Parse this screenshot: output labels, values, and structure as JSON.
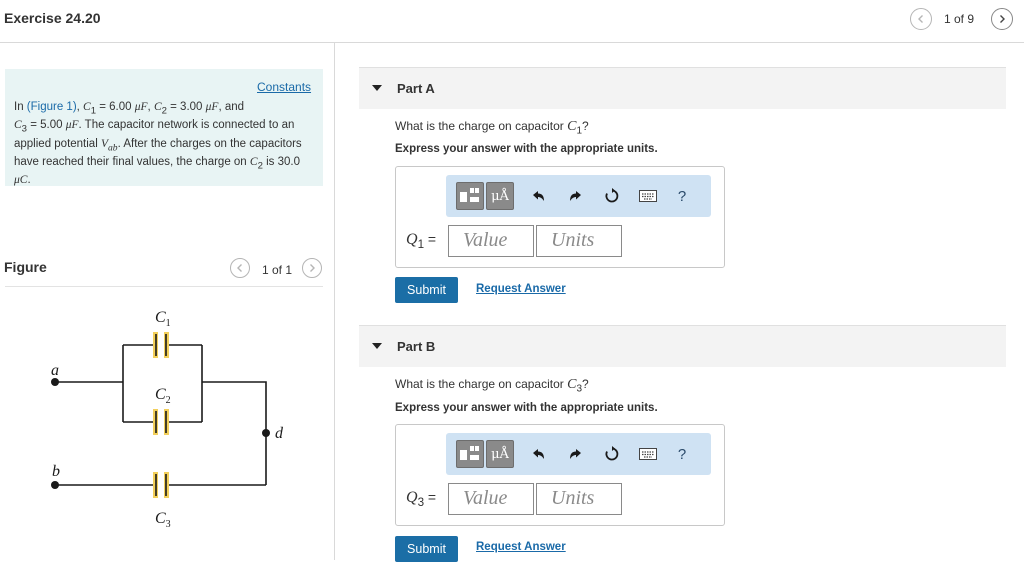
{
  "header": {
    "title": "Exercise 24.20",
    "page_count": "1 of 9"
  },
  "problem": {
    "constants_link": "Constants",
    "intro": "In ",
    "figure_link": "(Figure 1)",
    "c1_label": "C",
    "c1_sub": "1",
    "c1_value": " = 6.00 ",
    "c1_unit": "μF",
    "c2_label": "C",
    "c2_sub": "2",
    "c2_value": " = 3.00 ",
    "c2_unit": "μF",
    "and_text": ", and",
    "c3_label": "C",
    "c3_sub": "3",
    "c3_value": " = 5.00 ",
    "c3_unit": "μF",
    "text_1": ". The capacitor network is connected to an applied potential ",
    "vab_label": "V",
    "vab_sub": "ab",
    "text_2": ". After the charges on the capacitors have reached their final values, the charge on ",
    "c2b_label": "C",
    "c2b_sub": "2",
    "text_3": " is 30.0 ",
    "charge_unit": "μC",
    "period": "."
  },
  "figure": {
    "heading": "Figure",
    "count": "1 of 1",
    "labels": {
      "c1": "C",
      "c1_sub": "1",
      "c2": "C",
      "c2_sub": "2",
      "c3": "C",
      "c3_sub": "3",
      "a": "a",
      "b": "b",
      "d": "d"
    },
    "colors": {
      "plate_highlight": "#f2cf5b",
      "wire": "#1a1a1a"
    }
  },
  "parts": [
    {
      "label": "Part A",
      "question": "What is the charge on capacitor ",
      "question_var": "C",
      "question_sub": "1",
      "question_end": "?",
      "instruction": "Express your answer with the appropriate units.",
      "var_label": "Q",
      "var_sub": "1",
      "equals": " =",
      "value_placeholder": "Value",
      "units_placeholder": "Units",
      "submit": "Submit",
      "request": "Request Answer"
    },
    {
      "label": "Part B",
      "question": "What is the charge on capacitor ",
      "question_var": "C",
      "question_sub": "3",
      "question_end": "?",
      "instruction": "Express your answer with the appropriate units.",
      "var_label": "Q",
      "var_sub": "3",
      "equals": " =",
      "value_placeholder": "Value",
      "units_placeholder": "Units",
      "submit": "Submit",
      "request": "Request Answer"
    }
  ],
  "toolbar": {
    "units_symbol": "μÅ",
    "help_symbol": "?",
    "icons": [
      "template-icon",
      "units-icon",
      "undo-icon",
      "redo-icon",
      "reset-icon",
      "keyboard-icon",
      "help-icon"
    ]
  },
  "colors": {
    "link": "#1a6aa8",
    "submit_bg": "#1b6ea6",
    "problem_bg": "#e8f4f4",
    "toolbar_bg": "#cfe2f3"
  }
}
